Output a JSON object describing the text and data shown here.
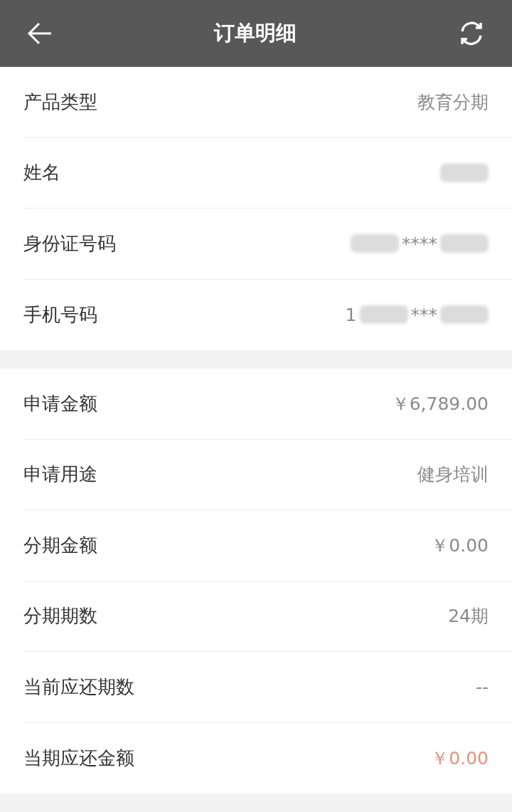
{
  "header": {
    "title": "订单明细"
  },
  "groups": [
    {
      "rows": [
        {
          "label": "产品类型",
          "value": [
            {
              "kind": "text",
              "text": "教育分期"
            }
          ],
          "accent": false
        },
        {
          "label": "姓名",
          "value": [
            {
              "kind": "redacted"
            }
          ],
          "accent": false
        },
        {
          "label": "身份证号码",
          "value": [
            {
              "kind": "redacted"
            },
            {
              "kind": "text",
              "text": "****"
            },
            {
              "kind": "redacted"
            }
          ],
          "accent": false
        },
        {
          "label": "手机号码",
          "value": [
            {
              "kind": "text",
              "text": "1"
            },
            {
              "kind": "redacted"
            },
            {
              "kind": "text",
              "text": "***"
            },
            {
              "kind": "redacted"
            }
          ],
          "accent": false
        }
      ]
    },
    {
      "rows": [
        {
          "label": "申请金额",
          "value": [
            {
              "kind": "text",
              "text": "￥6,789.00"
            }
          ],
          "accent": false
        },
        {
          "label": "申请用途",
          "value": [
            {
              "kind": "text",
              "text": "健身培训"
            }
          ],
          "accent": false
        },
        {
          "label": "分期金额",
          "value": [
            {
              "kind": "text",
              "text": "￥0.00"
            }
          ],
          "accent": false
        },
        {
          "label": "分期期数",
          "value": [
            {
              "kind": "text",
              "text": "24期"
            }
          ],
          "accent": false
        },
        {
          "label": "当前应还期数",
          "value": [
            {
              "kind": "text",
              "text": "--"
            }
          ],
          "accent": false
        },
        {
          "label": "当期应还金额",
          "value": [
            {
              "kind": "text",
              "text": "￥0.00"
            }
          ],
          "accent": true
        }
      ]
    }
  ]
}
